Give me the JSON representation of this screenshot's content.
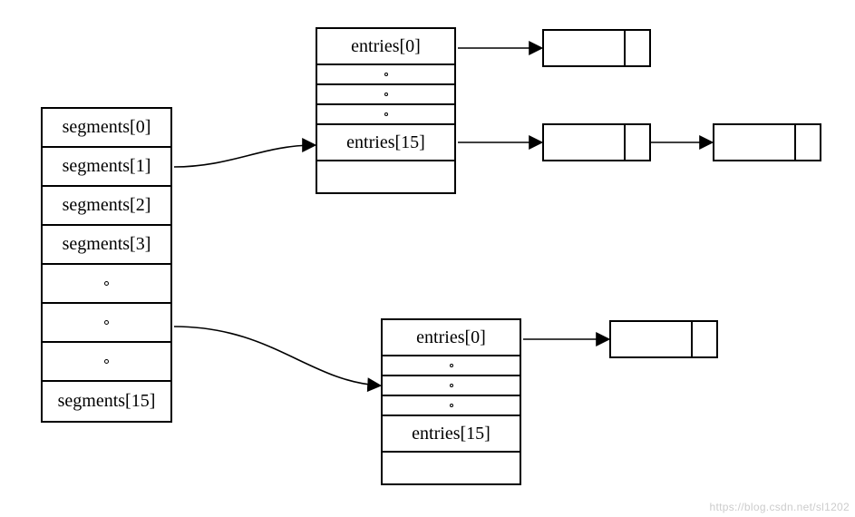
{
  "segments": {
    "rows": [
      {
        "label": "segments[0]"
      },
      {
        "label": "segments[1]"
      },
      {
        "label": "segments[2]"
      },
      {
        "label": "segments[3]"
      }
    ],
    "last_label": "segments[15]"
  },
  "entries_top": {
    "first_label": "entries[0]",
    "last_label": "entries[15]"
  },
  "entries_bottom": {
    "first_label": "entries[0]",
    "last_label": "entries[15]"
  },
  "watermark": "https://blog.csdn.net/sl1202"
}
